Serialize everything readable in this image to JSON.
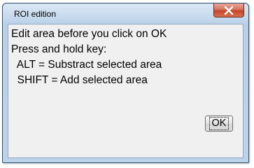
{
  "window": {
    "title": "ROI edition"
  },
  "close_icon": "close-x-icon",
  "message": {
    "lines": [
      "Edit area before you click on OK",
      "Press and hold key:",
      "  ALT = Substract selected area",
      "  SHIFT = Add selected area"
    ]
  },
  "buttons": {
    "ok_label": "OK"
  },
  "colors": {
    "titlebar": "#c8dbee",
    "close_button": "#c4452a",
    "client_bg": "#f0f0f0"
  }
}
